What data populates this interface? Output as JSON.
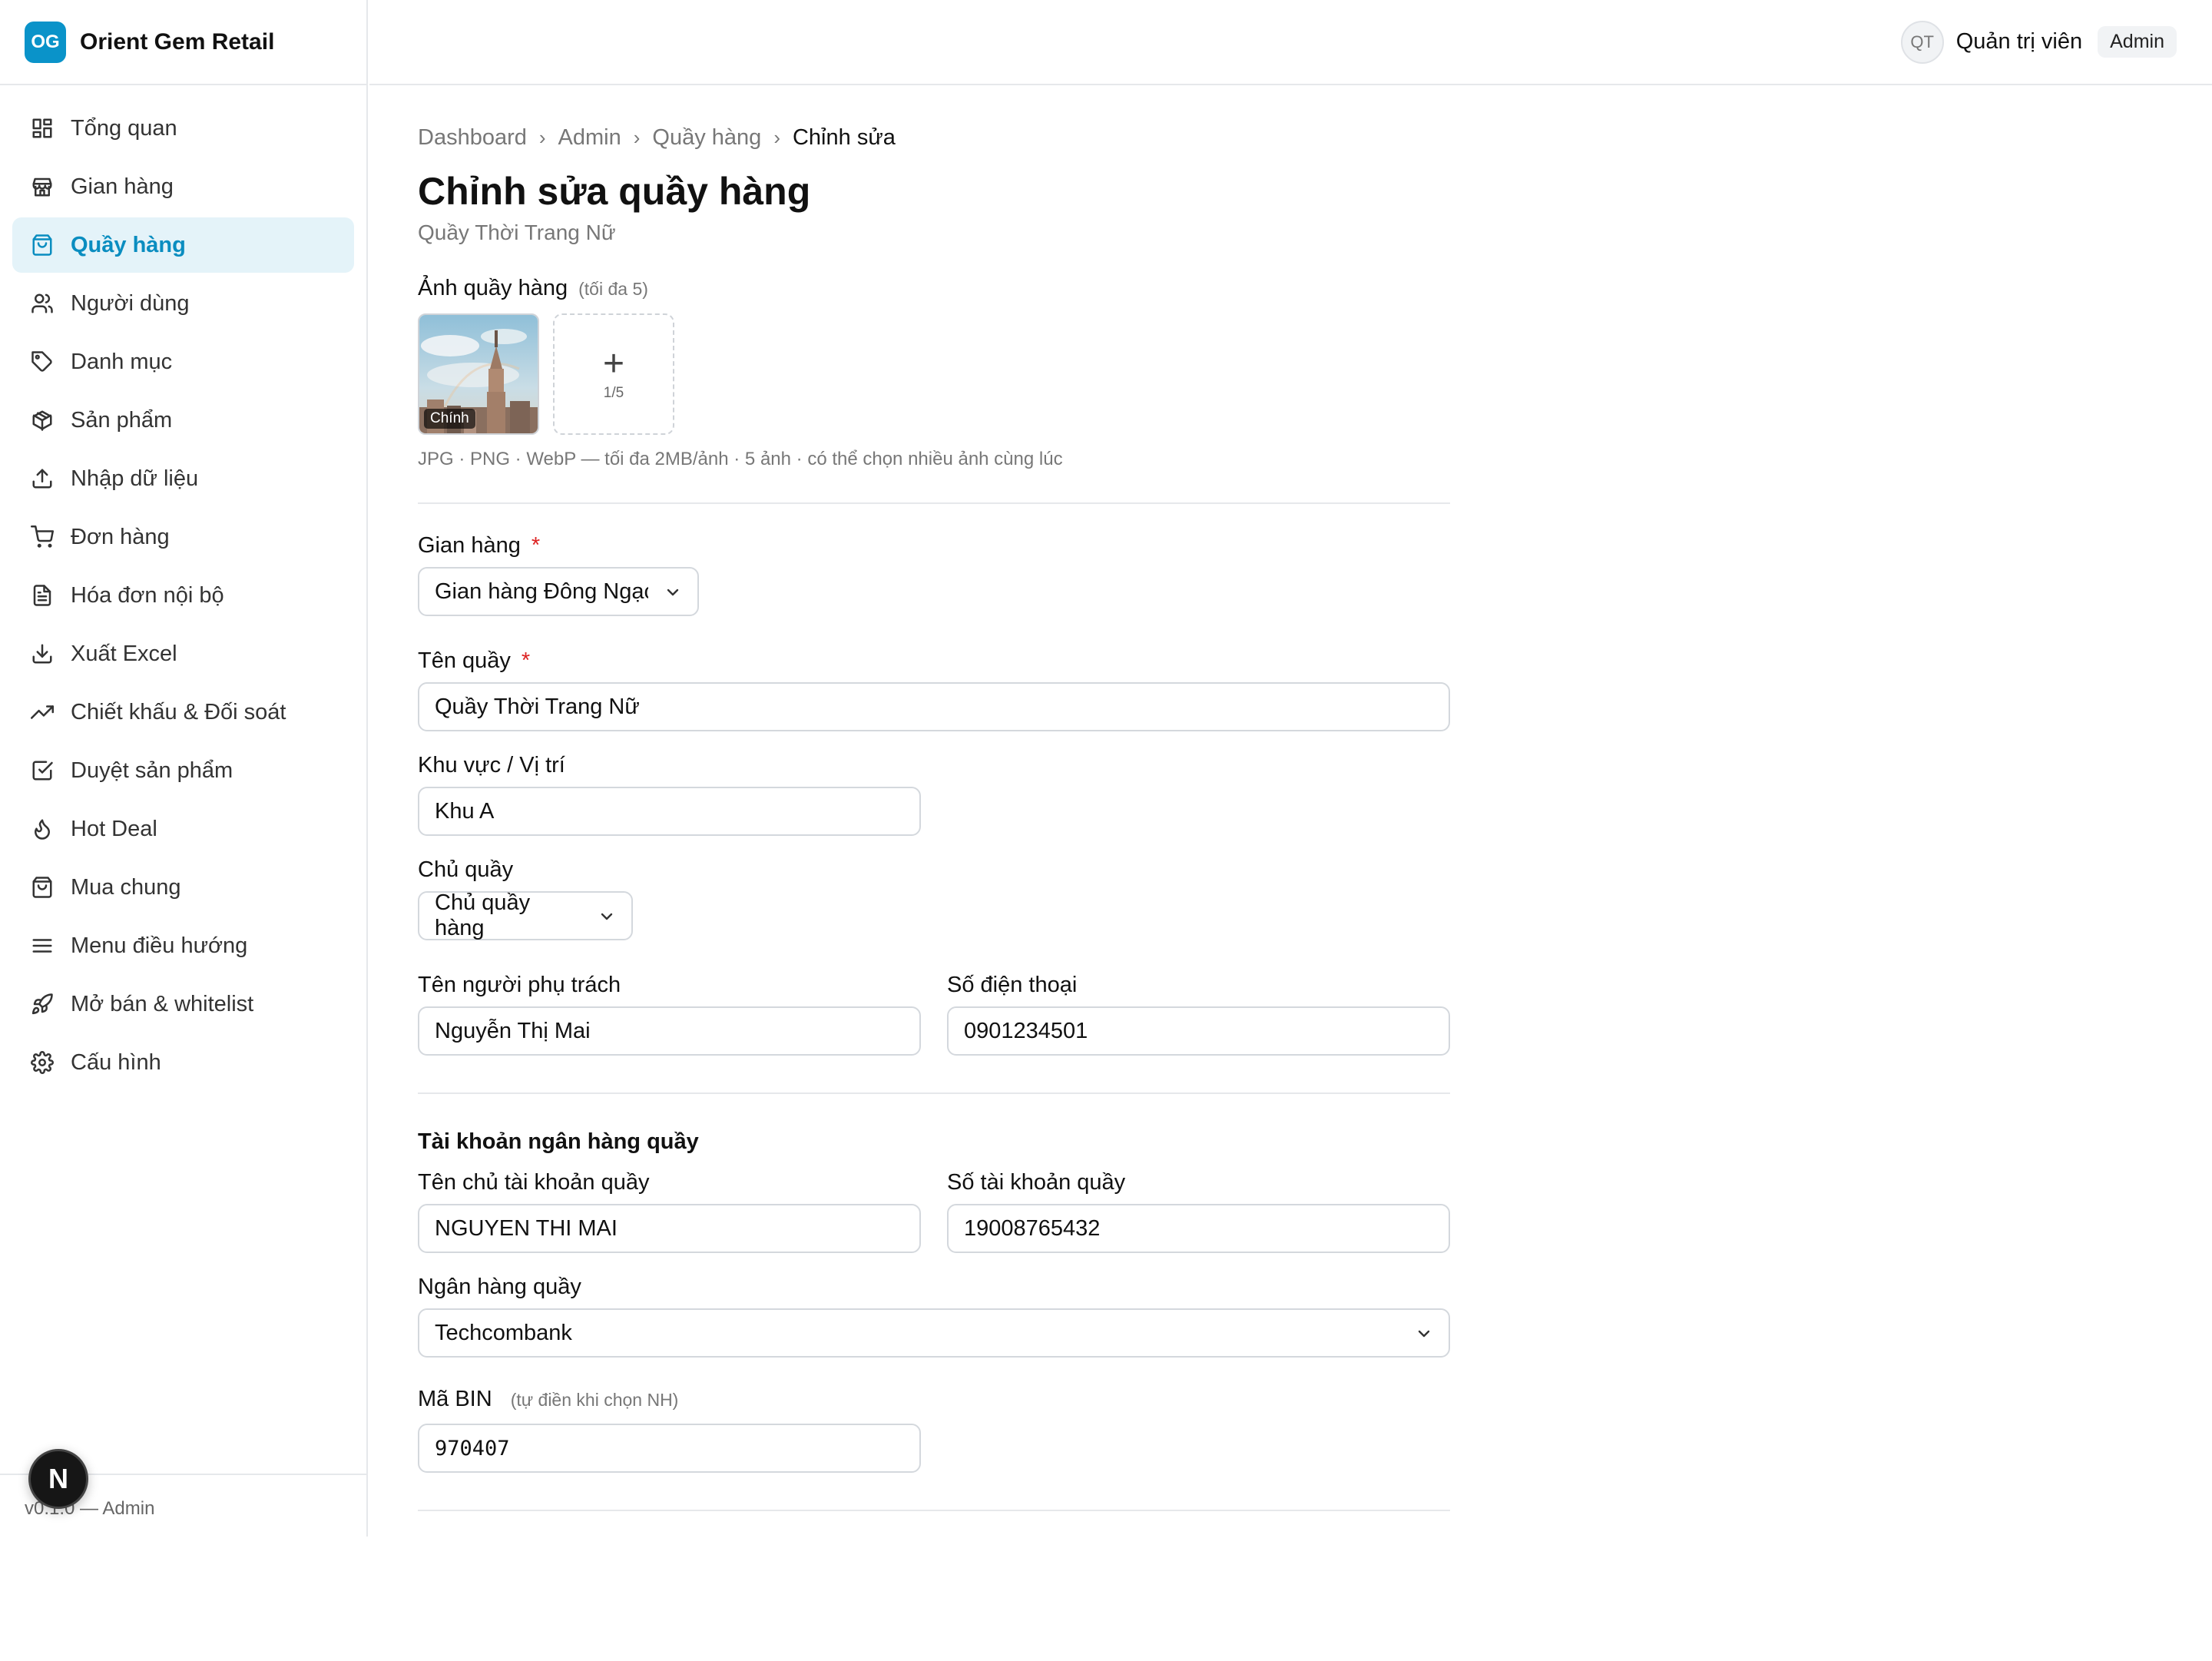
{
  "brand": {
    "logo_text": "OG",
    "name": "Orient Gem Retail"
  },
  "topbar": {
    "avatar_initials": "QT",
    "user_name": "Quản trị viên",
    "role": "Admin"
  },
  "sidebar": {
    "items": [
      {
        "label": "Tổng quan",
        "icon": "dashboard-icon"
      },
      {
        "label": "Gian hàng",
        "icon": "store-icon"
      },
      {
        "label": "Quầy hàng",
        "icon": "shopping-bag-icon",
        "active": true
      },
      {
        "label": "Người dùng",
        "icon": "users-icon"
      },
      {
        "label": "Danh mục",
        "icon": "tag-icon"
      },
      {
        "label": "Sản phẩm",
        "icon": "package-icon"
      },
      {
        "label": "Nhập dữ liệu",
        "icon": "upload-icon"
      },
      {
        "label": "Đơn hàng",
        "icon": "cart-icon"
      },
      {
        "label": "Hóa đơn nội bộ",
        "icon": "file-text-icon"
      },
      {
        "label": "Xuất Excel",
        "icon": "download-icon"
      },
      {
        "label": "Chiết khấu & Đối soát",
        "icon": "trending-up-icon"
      },
      {
        "label": "Duyệt sản phẩm",
        "icon": "check-square-icon"
      },
      {
        "label": "Hot Deal",
        "icon": "flame-icon"
      },
      {
        "label": "Mua chung",
        "icon": "shopping-bag-icon"
      },
      {
        "label": "Menu điều hướng",
        "icon": "menu-icon"
      },
      {
        "label": "Mở bán & whitelist",
        "icon": "rocket-icon"
      },
      {
        "label": "Cấu hình",
        "icon": "gear-icon"
      }
    ],
    "footer": "v0.1.0 — Admin",
    "next_badge": "N"
  },
  "breadcrumb": {
    "items": [
      "Dashboard",
      "Admin",
      "Quầy hàng"
    ],
    "current": "Chỉnh sửa"
  },
  "page": {
    "title": "Chỉnh sửa quầy hàng",
    "subtitle": "Quầy Thời Trang Nữ"
  },
  "photos": {
    "label": "Ảnh quầy hàng",
    "hint": "(tối đa 5)",
    "main_tag": "Chính",
    "add_count": "1/5",
    "note": "JPG · PNG · WebP — tối đa 2MB/ảnh · 5 ảnh · có thể chọn nhiều ảnh cùng lúc"
  },
  "form": {
    "store": {
      "label": "Gian hàng",
      "required": "*",
      "value": "Gian hàng Đông Ngạc"
    },
    "counter_name": {
      "label": "Tên quầy",
      "required": "*",
      "value": "Quầy Thời Trang Nữ"
    },
    "area": {
      "label": "Khu vực / Vị trí",
      "value": "Khu A"
    },
    "owner": {
      "label": "Chủ quầy",
      "value": "Chủ quầy hàng"
    },
    "manager_name": {
      "label": "Tên người phụ trách",
      "value": "Nguyễn Thị Mai"
    },
    "phone": {
      "label": "Số điện thoại",
      "value": "0901234501"
    }
  },
  "bank": {
    "heading": "Tài khoản ngân hàng quầy",
    "holder": {
      "label": "Tên chủ tài khoản quầy",
      "value": "NGUYEN THI MAI"
    },
    "account_number": {
      "label": "Số tài khoản quầy",
      "value": "19008765432"
    },
    "bank_name": {
      "label": "Ngân hàng quầy",
      "value": "Techcombank"
    },
    "bin": {
      "label": "Mã BIN",
      "hint": "(tự điền khi chọn NH)",
      "value": "970407"
    }
  },
  "colors": {
    "accent": "#0a8dc0",
    "active_bg": "#e4f3f9",
    "logo_bg": "#0a93c9",
    "required": "#dd2222"
  }
}
